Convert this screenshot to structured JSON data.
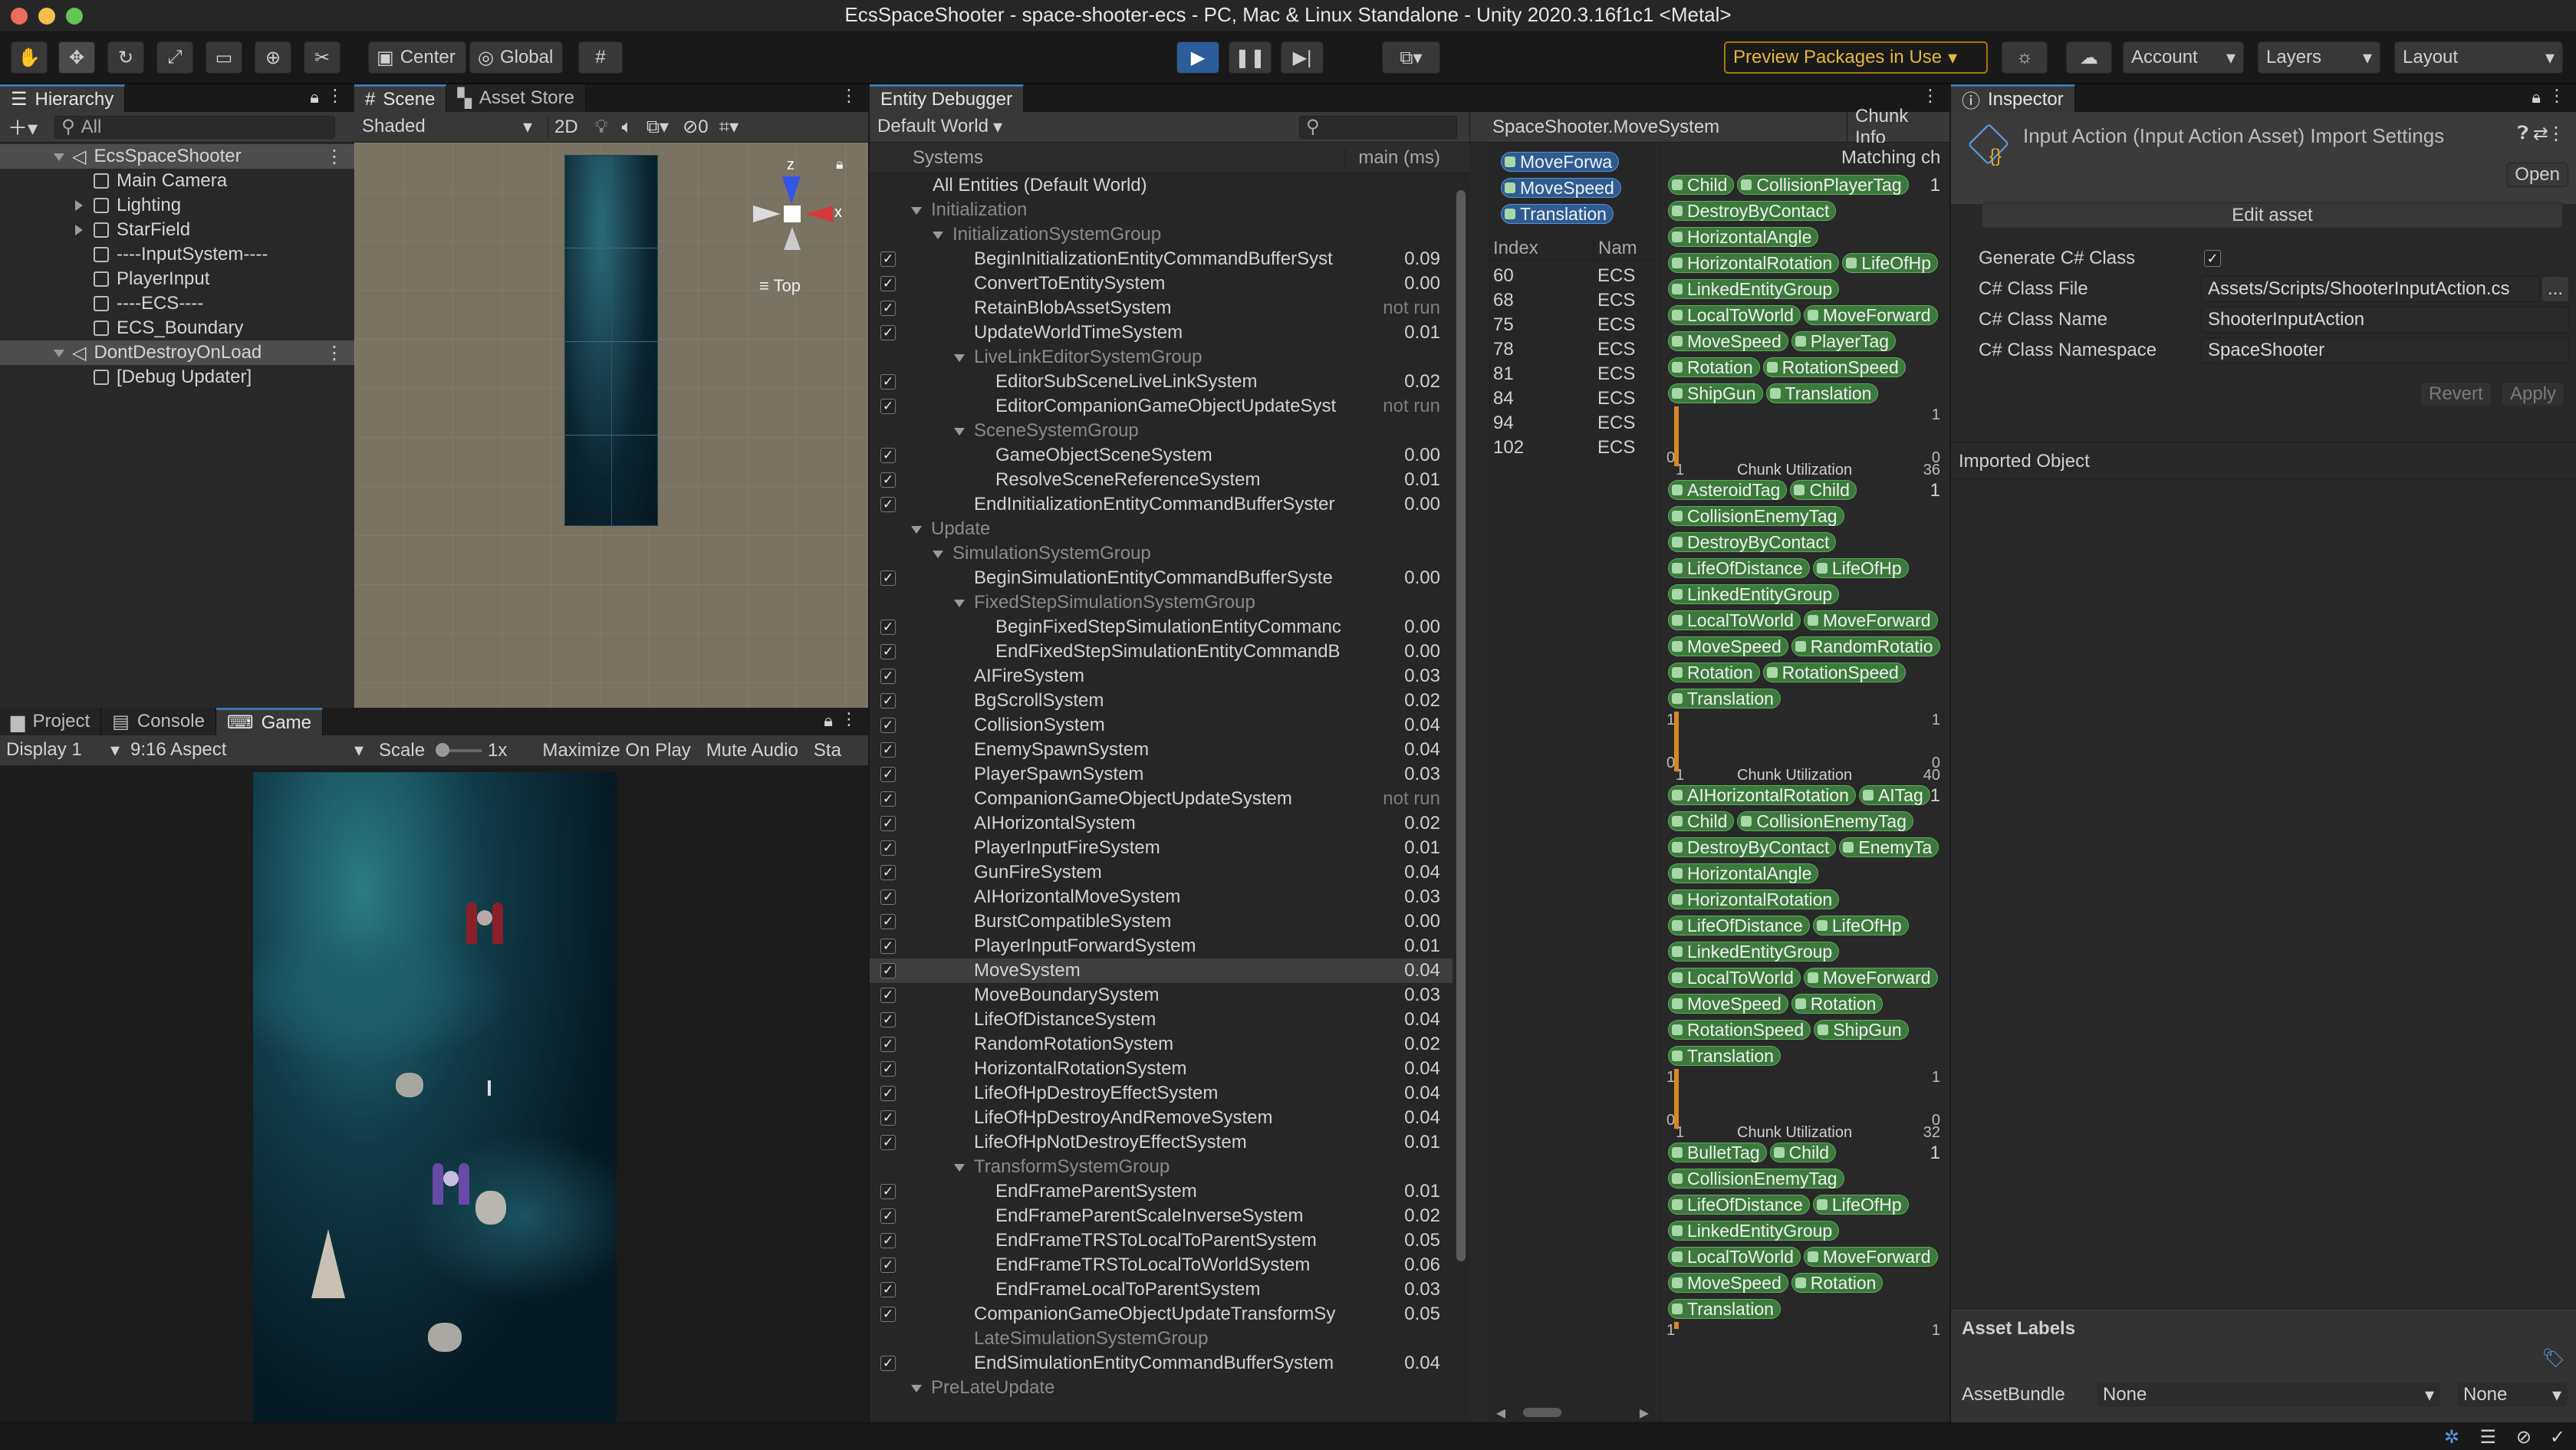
{
  "window": {
    "title": "EcsSpaceShooter - space-shooter-ecs - PC, Mac & Linux Standalone - Unity 2020.3.16f1c1 <Metal>"
  },
  "toolbar": {
    "center_label": "Center",
    "global_label": "Global",
    "preview_packages": "Preview Packages in Use",
    "account": "Account",
    "layers": "Layers",
    "layout": "Layout"
  },
  "hierarchy": {
    "tab": "Hierarchy",
    "search_placeholder": "All",
    "items": [
      {
        "label": "EcsSpaceShooter",
        "depth": 0,
        "kind": "scene",
        "selected": true
      },
      {
        "label": "Main Camera",
        "depth": 1,
        "kind": "object"
      },
      {
        "label": "Lighting",
        "depth": 1,
        "kind": "object",
        "expandable": true
      },
      {
        "label": "StarField",
        "depth": 1,
        "kind": "object",
        "expandable": true
      },
      {
        "label": "----InputSystem----",
        "depth": 1,
        "kind": "object"
      },
      {
        "label": "PlayerInput",
        "depth": 1,
        "kind": "object"
      },
      {
        "label": "----ECS----",
        "depth": 1,
        "kind": "object"
      },
      {
        "label": "ECS_Boundary",
        "depth": 1,
        "kind": "object"
      },
      {
        "label": "DontDestroyOnLoad",
        "depth": 0,
        "kind": "scene",
        "selected": true
      },
      {
        "label": "[Debug Updater]",
        "depth": 1,
        "kind": "object"
      }
    ]
  },
  "scene": {
    "tabs": [
      "Scene",
      "Asset Store"
    ],
    "shading": "Shaded",
    "mode_2d": "2D",
    "hidden_count": "0",
    "gizmo_label": "Top",
    "axis_z": "z",
    "axis_x": "x"
  },
  "bottom_tabs": [
    "Project",
    "Console",
    "Game"
  ],
  "game": {
    "display": "Display 1",
    "aspect": "9:16 Aspect",
    "scale_label": "Scale",
    "scale_value": "1x",
    "maximize": "Maximize On Play",
    "mute": "Mute Audio",
    "stats": "Sta"
  },
  "entity_debugger": {
    "tab": "Entity Debugger",
    "world": "Default World",
    "systems_header": "Systems",
    "time_header": "main (ms)",
    "selected_system": "SpaceShooter.MoveSystem",
    "chunk_info": "Chunk Info",
    "matching": "Matching ch",
    "query_chips": [
      "MoveForwa",
      "MoveSpeed",
      "Translation"
    ],
    "index_header": "Index",
    "name_header": "Nam",
    "entities": [
      {
        "index": "60",
        "name": "ECS"
      },
      {
        "index": "68",
        "name": "ECS"
      },
      {
        "index": "75",
        "name": "ECS"
      },
      {
        "index": "78",
        "name": "ECS"
      },
      {
        "index": "81",
        "name": "ECS"
      },
      {
        "index": "84",
        "name": "ECS"
      },
      {
        "index": "94",
        "name": "ECS"
      },
      {
        "index": "102",
        "name": "ECS"
      }
    ],
    "systems": [
      {
        "name": "All Entities (Default World)",
        "indent": 1,
        "group": false,
        "check": false,
        "time": ""
      },
      {
        "name": "Initialization",
        "indent": 0,
        "group": true,
        "fold": true,
        "time": ""
      },
      {
        "name": "InitializationSystemGroup",
        "indent": 1,
        "group": true,
        "fold": true,
        "time": ""
      },
      {
        "name": "BeginInitializationEntityCommandBufferSyst",
        "indent": 2,
        "check": true,
        "time": "0.09"
      },
      {
        "name": "ConvertToEntitySystem",
        "indent": 2,
        "check": true,
        "time": "0.00"
      },
      {
        "name": "RetainBlobAssetSystem",
        "indent": 2,
        "check": true,
        "time": "not run"
      },
      {
        "name": "UpdateWorldTimeSystem",
        "indent": 2,
        "check": true,
        "time": "0.01"
      },
      {
        "name": "LiveLinkEditorSystemGroup",
        "indent": 2,
        "group": true,
        "fold": true,
        "time": ""
      },
      {
        "name": "EditorSubSceneLiveLinkSystem",
        "indent": 3,
        "check": true,
        "time": "0.02"
      },
      {
        "name": "EditorCompanionGameObjectUpdateSyst",
        "indent": 3,
        "check": true,
        "time": "not run"
      },
      {
        "name": "SceneSystemGroup",
        "indent": 2,
        "group": true,
        "fold": true,
        "time": ""
      },
      {
        "name": "GameObjectSceneSystem",
        "indent": 3,
        "check": true,
        "time": "0.00"
      },
      {
        "name": "ResolveSceneReferenceSystem",
        "indent": 3,
        "check": true,
        "time": "0.01"
      },
      {
        "name": "EndInitializationEntityCommandBufferSyster",
        "indent": 2,
        "check": true,
        "time": "0.00"
      },
      {
        "name": "Update",
        "indent": 0,
        "group": true,
        "fold": true,
        "time": ""
      },
      {
        "name": "SimulationSystemGroup",
        "indent": 1,
        "group": true,
        "fold": true,
        "time": ""
      },
      {
        "name": "BeginSimulationEntityCommandBufferSyste",
        "indent": 2,
        "check": true,
        "time": "0.00"
      },
      {
        "name": "FixedStepSimulationSystemGroup",
        "indent": 2,
        "group": true,
        "fold": true,
        "time": ""
      },
      {
        "name": "BeginFixedStepSimulationEntityCommanc",
        "indent": 3,
        "check": true,
        "time": "0.00"
      },
      {
        "name": "EndFixedStepSimulationEntityCommandB",
        "indent": 3,
        "check": true,
        "time": "0.00"
      },
      {
        "name": "AIFireSystem",
        "indent": 2,
        "check": true,
        "time": "0.03"
      },
      {
        "name": "BgScrollSystem",
        "indent": 2,
        "check": true,
        "time": "0.02"
      },
      {
        "name": "CollisionSystem",
        "indent": 2,
        "check": true,
        "time": "0.04"
      },
      {
        "name": "EnemySpawnSystem",
        "indent": 2,
        "check": true,
        "time": "0.04"
      },
      {
        "name": "PlayerSpawnSystem",
        "indent": 2,
        "check": true,
        "time": "0.03"
      },
      {
        "name": "CompanionGameObjectUpdateSystem",
        "indent": 2,
        "check": true,
        "time": "not run"
      },
      {
        "name": "AIHorizontalSystem",
        "indent": 2,
        "check": true,
        "time": "0.02"
      },
      {
        "name": "PlayerInputFireSystem",
        "indent": 2,
        "check": true,
        "time": "0.01"
      },
      {
        "name": "GunFireSystem",
        "indent": 2,
        "check": true,
        "time": "0.04"
      },
      {
        "name": "AIHorizontalMoveSystem",
        "indent": 2,
        "check": true,
        "time": "0.03"
      },
      {
        "name": "BurstCompatibleSystem",
        "indent": 2,
        "check": true,
        "time": "0.00"
      },
      {
        "name": "PlayerInputForwardSystem",
        "indent": 2,
        "check": true,
        "time": "0.01"
      },
      {
        "name": "MoveSystem",
        "indent": 2,
        "check": true,
        "time": "0.04",
        "selected": true
      },
      {
        "name": "MoveBoundarySystem",
        "indent": 2,
        "check": true,
        "time": "0.03"
      },
      {
        "name": "LifeOfDistanceSystem",
        "indent": 2,
        "check": true,
        "time": "0.04"
      },
      {
        "name": "RandomRotationSystem",
        "indent": 2,
        "check": true,
        "time": "0.02"
      },
      {
        "name": "HorizontalRotationSystem",
        "indent": 2,
        "check": true,
        "time": "0.04"
      },
      {
        "name": "LifeOfHpDestroyEffectSystem",
        "indent": 2,
        "check": true,
        "time": "0.04"
      },
      {
        "name": "LifeOfHpDestroyAndRemoveSystem",
        "indent": 2,
        "check": true,
        "time": "0.04"
      },
      {
        "name": "LifeOfHpNotDestroyEffectSystem",
        "indent": 2,
        "check": true,
        "time": "0.01"
      },
      {
        "name": "TransformSystemGroup",
        "indent": 2,
        "group": true,
        "fold": true,
        "time": ""
      },
      {
        "name": "EndFrameParentSystem",
        "indent": 3,
        "check": true,
        "time": "0.01"
      },
      {
        "name": "EndFrameParentScaleInverseSystem",
        "indent": 3,
        "check": true,
        "time": "0.02"
      },
      {
        "name": "EndFrameTRSToLocalToParentSystem",
        "indent": 3,
        "check": true,
        "time": "0.05"
      },
      {
        "name": "EndFrameTRSToLocalToWorldSystem",
        "indent": 3,
        "check": true,
        "time": "0.06"
      },
      {
        "name": "EndFrameLocalToParentSystem",
        "indent": 3,
        "check": true,
        "time": "0.03"
      },
      {
        "name": "CompanionGameObjectUpdateTransformSy",
        "indent": 2,
        "check": true,
        "time": "0.05"
      },
      {
        "name": "LateSimulationSystemGroup",
        "indent": 2,
        "group": true,
        "time": ""
      },
      {
        "name": "EndSimulationEntityCommandBufferSystem",
        "indent": 2,
        "check": true,
        "time": "0.04"
      },
      {
        "name": "PreLateUpdate",
        "indent": 0,
        "group": true,
        "fold": true,
        "time": ""
      }
    ],
    "chunks": [
      {
        "components": [
          [
            "Child",
            "CollisionPlayerTag"
          ],
          [
            "DestroyByContact"
          ],
          [
            "HorizontalAngle"
          ],
          [
            "HorizontalRotation",
            "LifeOfHp"
          ],
          [
            "LinkedEntityGroup"
          ],
          [
            "LocalToWorld",
            "MoveForward"
          ],
          [
            "MoveSpeed",
            "PlayerTag"
          ],
          [
            "Rotation",
            "RotationSpeed"
          ],
          [
            "ShipGun",
            "Translation"
          ]
        ],
        "chunk_count_right": "1",
        "caption": "Chunk Utilization",
        "max": "36",
        "y_top": "",
        "y_bottom": "0",
        "x_left": "1",
        "bar_fraction": 1.0
      },
      {
        "components": [
          [
            "AsteroidTag",
            "Child"
          ],
          [
            "CollisionEnemyTag"
          ],
          [
            "DestroyByContact"
          ],
          [
            "LifeOfDistance",
            "LifeOfHp"
          ],
          [
            "LinkedEntityGroup"
          ],
          [
            "LocalToWorld",
            "MoveForward"
          ],
          [
            "MoveSpeed",
            "RandomRotatio"
          ],
          [
            "Rotation",
            "RotationSpeed"
          ],
          [
            "Translation"
          ]
        ],
        "chunk_count_right": "1",
        "caption": "Chunk Utilization",
        "max": "40",
        "y_top": "1",
        "y_bottom": "0",
        "x_left": "1",
        "bar_fraction": 1.0
      },
      {
        "components": [
          [
            "AIHorizontalRotation",
            "AITag"
          ],
          [
            "Child",
            "CollisionEnemyTag"
          ],
          [
            "DestroyByContact",
            "EnemyTa"
          ],
          [
            "HorizontalAngle"
          ],
          [
            "HorizontalRotation"
          ],
          [
            "LifeOfDistance",
            "LifeOfHp"
          ],
          [
            "LinkedEntityGroup"
          ],
          [
            "LocalToWorld",
            "MoveForward"
          ],
          [
            "MoveSpeed",
            "Rotation"
          ],
          [
            "RotationSpeed",
            "ShipGun"
          ],
          [
            "Translation"
          ]
        ],
        "chunk_count_right": "1",
        "caption": "Chunk Utilization",
        "max": "32",
        "y_top": "1",
        "y_bottom": "0",
        "x_left": "1",
        "bar_fraction": 1.0
      },
      {
        "components": [
          [
            "BulletTag",
            "Child"
          ],
          [
            "CollisionEnemyTag"
          ],
          [
            "LifeOfDistance",
            "LifeOfHp"
          ],
          [
            "LinkedEntityGroup"
          ],
          [
            "LocalToWorld",
            "MoveForward"
          ],
          [
            "MoveSpeed",
            "Rotation"
          ],
          [
            "Translation"
          ]
        ],
        "chunk_count_right": "1",
        "caption": "",
        "max": "",
        "y_top": "1",
        "y_bottom": "",
        "x_left": "",
        "bar_fraction": 0.3
      }
    ]
  },
  "inspector": {
    "tab": "Inspector",
    "asset_title": "Input Action (Input Action Asset) Import Settings",
    "open_button": "Open",
    "edit_asset": "Edit asset",
    "generate_label": "Generate C# Class",
    "generate_checked": true,
    "class_file_label": "C# Class File",
    "class_file_value": "Assets/Scripts/ShooterInputAction.cs",
    "class_file_browse": "...",
    "class_name_label": "C# Class Name",
    "class_name_value": "ShooterInputAction",
    "namespace_label": "C# Class Namespace",
    "namespace_value": "SpaceShooter",
    "revert": "Revert",
    "apply": "Apply",
    "imported_object": "Imported Object",
    "asset_labels": "Asset Labels",
    "asset_bundle_label": "AssetBundle",
    "asset_bundle_value": "None",
    "asset_bundle_variant": "None"
  },
  "colors": {
    "accent_blue": "#3a79bb",
    "chip_green": "#3c7a3c",
    "chip_blue": "#2e5c92",
    "bar_orange": "#d9862a",
    "preview_yellow": "#e5b63a"
  }
}
